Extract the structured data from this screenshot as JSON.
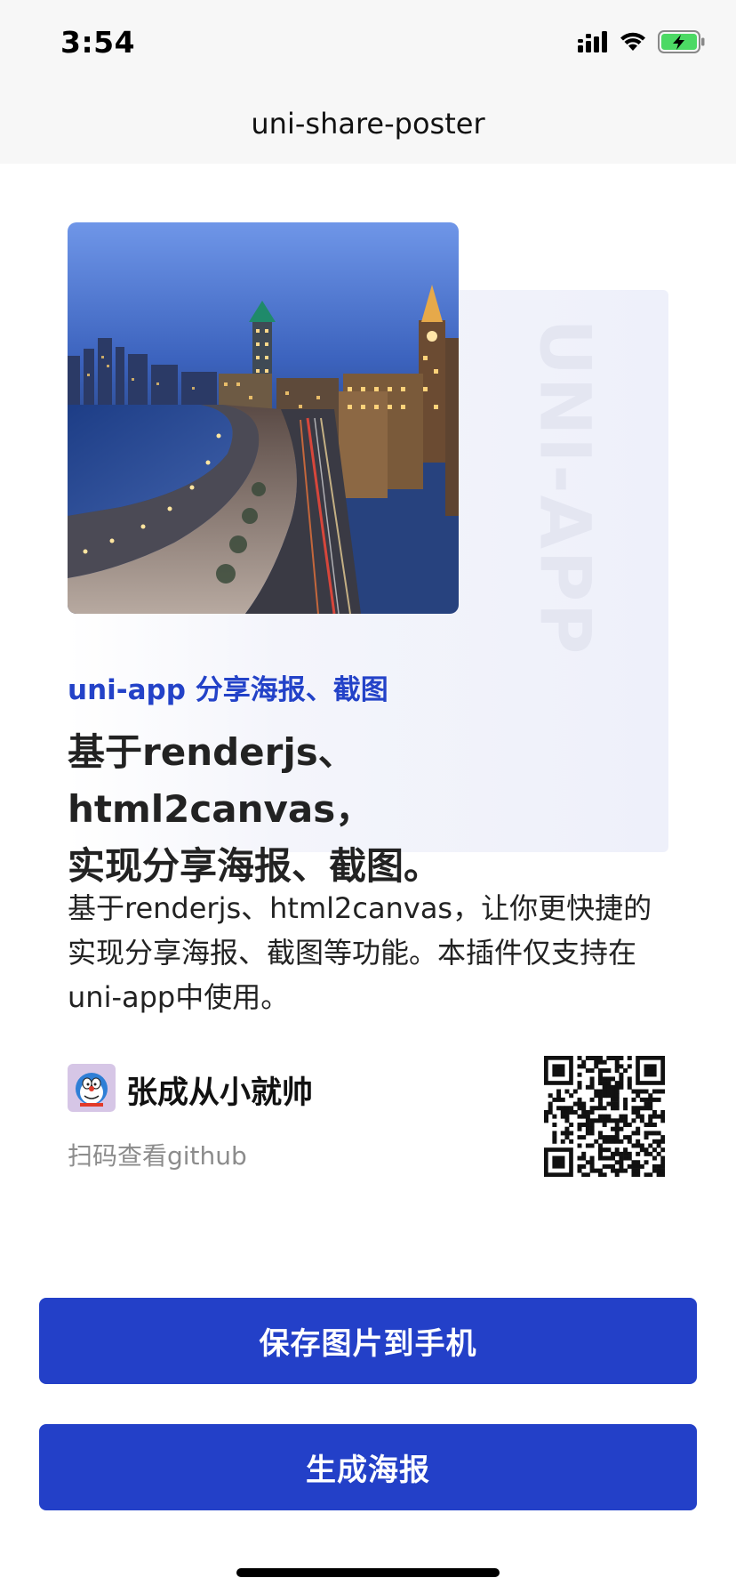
{
  "status_bar": {
    "time": "3:54",
    "icons": [
      "signal-icon",
      "wifi-icon",
      "battery-charging-icon"
    ],
    "battery_color": "#4cd964"
  },
  "nav": {
    "title": "uni-share-poster"
  },
  "poster": {
    "watermark": "UNI-APP",
    "photo": "city-night-bund-image",
    "tagline": "uni-app 分享海报、截图",
    "headline_line1": "基于renderjs、html2canvas，",
    "headline_line2": "实现分享海报、截图。",
    "description": "基于renderjs、html2canvas，让你更快捷的实现分享海报、截图等功能。本插件仅支持在uni-app中使用。",
    "author_name": "张成从小就帅",
    "scan_text": "扫码查看github",
    "accent_color": "#2342c8"
  },
  "buttons": {
    "save_label": "保存图片到手机",
    "generate_label": "生成海报",
    "color": "#2340c8"
  }
}
